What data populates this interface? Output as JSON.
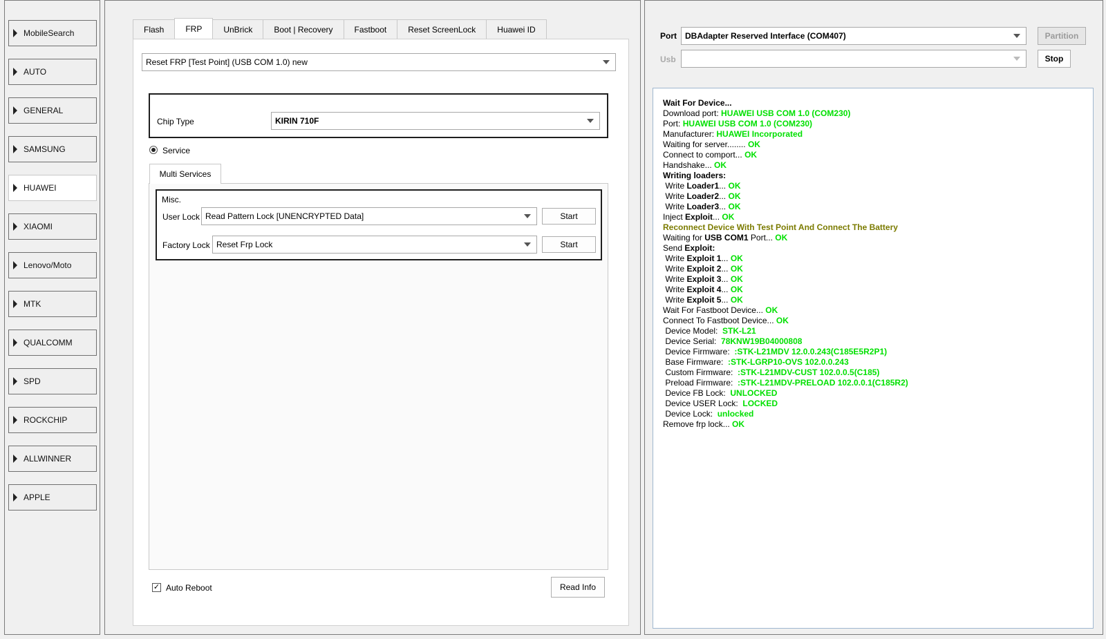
{
  "sidebar": {
    "items": [
      {
        "label": "MobileSearch"
      },
      {
        "label": "AUTO"
      },
      {
        "label": "GENERAL"
      },
      {
        "label": "SAMSUNG"
      },
      {
        "label": "HUAWEI"
      },
      {
        "label": "XIAOMI"
      },
      {
        "label": "Lenovo/Moto"
      },
      {
        "label": "MTK"
      },
      {
        "label": "QUALCOMM"
      },
      {
        "label": "SPD"
      },
      {
        "label": "ROCKCHIP"
      },
      {
        "label": "ALLWINNER"
      },
      {
        "label": "APPLE"
      }
    ],
    "active_index": 4
  },
  "middle": {
    "tabs": [
      {
        "label": "Flash"
      },
      {
        "label": "FRP"
      },
      {
        "label": "UnBrick"
      },
      {
        "label": "Boot | Recovery"
      },
      {
        "label": "Fastboot"
      },
      {
        "label": "Reset ScreenLock"
      },
      {
        "label": "Huawei ID"
      }
    ],
    "active_tab": 1,
    "operation_select": "Reset FRP [Test Point] (USB COM 1.0) new",
    "chip_type_label": "Chip Type",
    "chip_type_value": "KIRIN 710F",
    "service_radio_label": "Service",
    "subtab_label": "Multi Services",
    "misc_title": "Misc.",
    "user_lock_label": "User Lock",
    "user_lock_value": "Read Pattern Lock [UNENCRYPTED Data]",
    "factory_lock_label": "Factory Lock",
    "factory_lock_value": "Reset Frp Lock",
    "start_label": "Start",
    "auto_reboot_label": "Auto Reboot",
    "auto_reboot_checked": true,
    "read_info_label": "Read Info"
  },
  "right": {
    "port_label": "Port",
    "port_value": "DBAdapter Reserved Interface (COM407)",
    "usb_label": "Usb",
    "usb_value": "",
    "partition_label": "Partition",
    "stop_label": "Stop",
    "log": [
      [
        {
          "t": "Wait For Device...",
          "c": "b"
        }
      ],
      [
        {
          "t": "Download port: "
        },
        {
          "t": "HUAWEI USB COM 1.0 (COM230)",
          "c": "ok"
        }
      ],
      [
        {
          "t": "Port: "
        },
        {
          "t": "HUAWEI USB COM 1.0 (COM230)",
          "c": "ok"
        }
      ],
      [
        {
          "t": "Manufacturer: "
        },
        {
          "t": "HUAWEI Incorporated",
          "c": "ok"
        }
      ],
      [
        {
          "t": "Waiting for server........ "
        },
        {
          "t": "OK",
          "c": "ok"
        }
      ],
      [
        {
          "t": "Connect to comport... "
        },
        {
          "t": "OK",
          "c": "ok"
        }
      ],
      [
        {
          "t": "Handshake... "
        },
        {
          "t": "OK",
          "c": "ok"
        }
      ],
      [
        {
          "t": "Writing loaders:",
          "c": "b"
        }
      ],
      [
        {
          "t": " Write "
        },
        {
          "t": "Loader1",
          "c": "b"
        },
        {
          "t": "... "
        },
        {
          "t": "OK",
          "c": "ok"
        }
      ],
      [
        {
          "t": " Write "
        },
        {
          "t": "Loader2",
          "c": "b"
        },
        {
          "t": "... "
        },
        {
          "t": "OK",
          "c": "ok"
        }
      ],
      [
        {
          "t": " Write "
        },
        {
          "t": "Loader3",
          "c": "b"
        },
        {
          "t": "... "
        },
        {
          "t": "OK",
          "c": "ok"
        }
      ],
      [
        {
          "t": "Inject "
        },
        {
          "t": "Exploit",
          "c": "b"
        },
        {
          "t": "... "
        },
        {
          "t": "OK",
          "c": "ok"
        }
      ],
      [
        {
          "t": "Reconnect Device With Test Point And Connect The Battery",
          "c": "warn"
        }
      ],
      [
        {
          "t": "Waiting for "
        },
        {
          "t": "USB COM1",
          "c": "b"
        },
        {
          "t": " Port... "
        },
        {
          "t": "OK",
          "c": "ok"
        }
      ],
      [
        {
          "t": "Send "
        },
        {
          "t": "Exploit:",
          "c": "b"
        }
      ],
      [
        {
          "t": " Write "
        },
        {
          "t": "Exploit 1",
          "c": "b"
        },
        {
          "t": "... "
        },
        {
          "t": "OK",
          "c": "ok"
        }
      ],
      [
        {
          "t": " Write "
        },
        {
          "t": "Exploit 2",
          "c": "b"
        },
        {
          "t": "... "
        },
        {
          "t": "OK",
          "c": "ok"
        }
      ],
      [
        {
          "t": " Write "
        },
        {
          "t": "Exploit 3",
          "c": "b"
        },
        {
          "t": "... "
        },
        {
          "t": "OK",
          "c": "ok"
        }
      ],
      [
        {
          "t": " Write "
        },
        {
          "t": "Exploit 4",
          "c": "b"
        },
        {
          "t": "... "
        },
        {
          "t": "OK",
          "c": "ok"
        }
      ],
      [
        {
          "t": " Write "
        },
        {
          "t": "Exploit 5",
          "c": "b"
        },
        {
          "t": "... "
        },
        {
          "t": "OK",
          "c": "ok"
        }
      ],
      [
        {
          "t": "Wait For Fastboot Device... "
        },
        {
          "t": "OK",
          "c": "ok"
        }
      ],
      [
        {
          "t": "Connect To Fastboot Device... "
        },
        {
          "t": "OK",
          "c": "ok"
        }
      ],
      [
        {
          "t": " Device Model:  "
        },
        {
          "t": "STK-L21",
          "c": "ok"
        }
      ],
      [
        {
          "t": " Device Serial:  "
        },
        {
          "t": "78KNW19B04000808",
          "c": "ok"
        }
      ],
      [
        {
          "t": " Device Firmware:  "
        },
        {
          "t": ":STK-L21MDV 12.0.0.243(C185E5R2P1)",
          "c": "ok"
        }
      ],
      [
        {
          "t": " Base Firmware:  "
        },
        {
          "t": ":STK-LGRP10-OVS 102.0.0.243",
          "c": "ok"
        }
      ],
      [
        {
          "t": " Custom Firmware:  "
        },
        {
          "t": ":STK-L21MDV-CUST 102.0.0.5(C185)",
          "c": "ok"
        }
      ],
      [
        {
          "t": " Preload Firmware:  "
        },
        {
          "t": ":STK-L21MDV-PRELOAD 102.0.0.1(C185R2)",
          "c": "ok"
        }
      ],
      [
        {
          "t": " Device FB Lock:  "
        },
        {
          "t": "UNLOCKED",
          "c": "ok"
        }
      ],
      [
        {
          "t": " Device USER Lock:  "
        },
        {
          "t": "LOCKED",
          "c": "ok"
        }
      ],
      [
        {
          "t": " Device Lock:  "
        },
        {
          "t": "unlocked",
          "c": "ok"
        }
      ],
      [
        {
          "t": "Remove frp lock... "
        },
        {
          "t": "OK",
          "c": "ok"
        }
      ]
    ]
  }
}
